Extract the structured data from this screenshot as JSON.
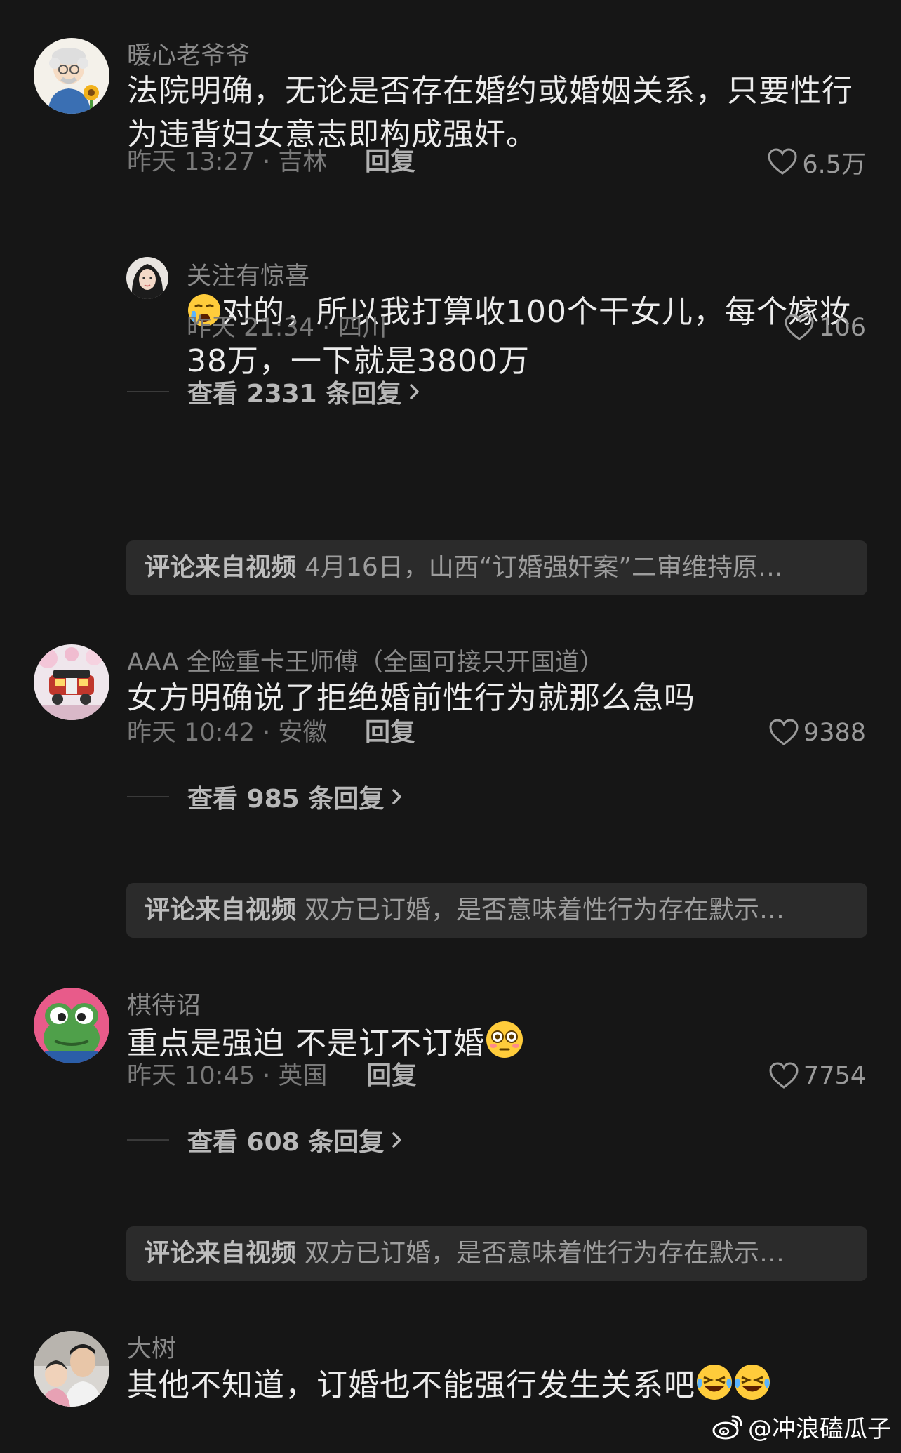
{
  "comments": [
    {
      "username": "暖心老爷爷",
      "text": "法院明确，无论是否存在婚约或婚姻关系，只要性行为违背妇女意志即构成强奸。",
      "meta": "昨天 13:27 · 吉林",
      "reply_label": "回复",
      "likes": "6.5万",
      "reply": {
        "username": "关注有惊喜",
        "emoji": "crying-sleepy-face",
        "text": "对的，所以我打算收100个干女儿，每个嫁妆38万，一下就是3800万",
        "meta": "昨天 21:34 · 四川",
        "likes": "106"
      },
      "view_replies": "查看 2331 条回复",
      "source_tag": "评论来自视频",
      "source_text": "4月16日，山西“订婚强奸案”二审维持原…"
    },
    {
      "username": "AAA 全险重卡王师傅（全国可接只开国道）",
      "text": "女方明确说了拒绝婚前性行为就那么急吗",
      "meta": "昨天 10:42 · 安徽",
      "reply_label": "回复",
      "likes": "9388",
      "view_replies": "查看 985 条回复",
      "source_tag": "评论来自视频",
      "source_text": "双方已订婚，是否意味着性行为存在默示…"
    },
    {
      "username": "棋待诏",
      "text": "重点是强迫 不是订不订婚",
      "trailing_emoji": "flushed-face",
      "meta": "昨天 10:45 · 英国",
      "reply_label": "回复",
      "likes": "7754",
      "view_replies": "查看 608 条回复",
      "source_tag": "评论来自视频",
      "source_text": "双方已订婚，是否意味着性行为存在默示…"
    },
    {
      "username": "大树",
      "text": "其他不知道，订婚也不能强行发生关系吧",
      "trailing_emoji": "rolling-laughing-face"
    }
  ],
  "watermark": "@冲浪磕瓜子",
  "colors": {
    "background": "#161616",
    "source_box": "#2b2b2b",
    "username": "#8a8a8a",
    "text": "#ececec"
  }
}
